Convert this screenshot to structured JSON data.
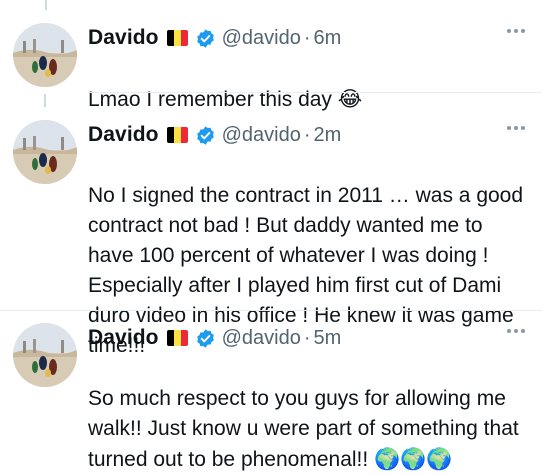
{
  "colors": {
    "name": "#0f1419",
    "secondary": "#536471",
    "verified": "#1d9bf0",
    "thread_line": "#cfd9de",
    "divider": "#e6ecf0"
  },
  "tweets": [
    {
      "author_name": "Davido",
      "flag": "belgium-flag-icon",
      "verified": "verified-badge-icon",
      "handle": "@davido",
      "separator": "·",
      "time": "6m",
      "text": "Lmao I remember this day",
      "emoji": "😂"
    },
    {
      "author_name": "Davido",
      "flag": "belgium-flag-icon",
      "verified": "verified-badge-icon",
      "handle": "@davido",
      "separator": "·",
      "time": "2m",
      "text": "No I signed the contract in 2011 … was a good contract not bad ! But daddy wanted me to have 100 percent of whatever I was doing ! Especially after I played him first cut of Dami duro video in his office ! He knew it was game time!!!",
      "emoji": ""
    },
    {
      "author_name": "Davido",
      "flag": "belgium-flag-icon",
      "verified": "verified-badge-icon",
      "handle": "@davido",
      "separator": "·",
      "time": "5m",
      "text": "So much respect to you guys for allowing  me walk!! Just know u were part of something that turned out to be phenomenal!!",
      "emoji": "🌍🌍🌍"
    }
  ]
}
